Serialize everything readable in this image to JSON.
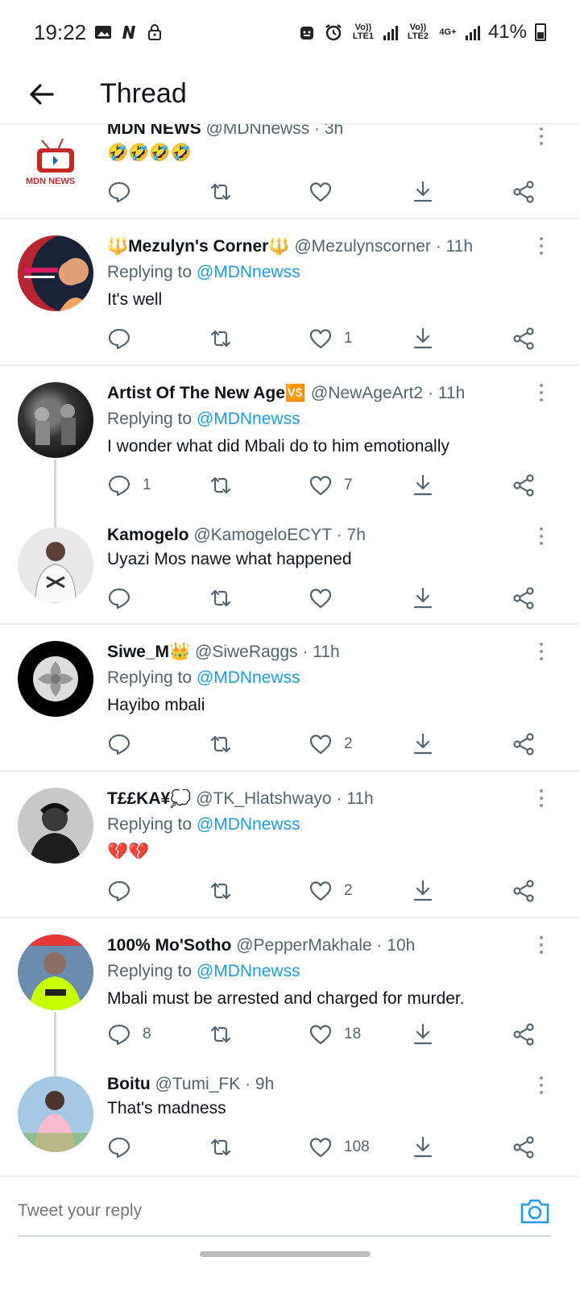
{
  "status_bar": {
    "time": "19:22",
    "net1": "Vo)) LTE1",
    "net2": "Vo)) LTE2",
    "net3": "4G+",
    "battery": "41%"
  },
  "header": {
    "back_icon": "arrow-left-icon",
    "title": "Thread"
  },
  "tweets": [
    {
      "name": "MDN NEWS",
      "handle": "@MDNnewss",
      "time": "· 3h",
      "replying_prefix": "",
      "replying_to": "",
      "text": "🤣🤣🤣🤣",
      "replies": "",
      "likes": ""
    },
    {
      "name": "🔱Mezulyn's Corner🔱",
      "handle": "@Mezulynscorner",
      "time": "· 11h",
      "replying_prefix": "Replying to",
      "replying_to": "@MDNnewss",
      "text": "It's well",
      "replies": "",
      "likes": "1"
    },
    {
      "name": "Artist Of The New Age🆚",
      "handle": "@NewAgeArt2",
      "time": "· 11h",
      "replying_prefix": "Replying to",
      "replying_to": "@MDNnewss",
      "text": "I wonder what did Mbali do to him emotionally",
      "replies": "1",
      "likes": "7"
    },
    {
      "name": "Kamogelo",
      "handle": "@KamogeloECYT",
      "time": "· 7h",
      "replying_prefix": "",
      "replying_to": "",
      "text": "Uyazi Mos nawe what happened",
      "replies": "",
      "likes": ""
    },
    {
      "name": "Siwe_M👑",
      "handle": "@SiweRaggs",
      "time": "· 11h",
      "replying_prefix": "Replying to",
      "replying_to": "@MDNnewss",
      "text": "Hayibo mbali",
      "replies": "",
      "likes": "2"
    },
    {
      "name": "T££KA¥💭",
      "handle": "@TK_Hlatshwayo",
      "time": "· 11h",
      "replying_prefix": "Replying to",
      "replying_to": "@MDNnewss",
      "text": "💔💔",
      "replies": "",
      "likes": "2"
    },
    {
      "name": "100% Mo'Sotho",
      "handle": "@PepperMakhale",
      "time": "· 10h",
      "replying_prefix": "Replying to",
      "replying_to": "@MDNnewss",
      "text": "Mbali must be arrested and charged for murder.",
      "replies": "8",
      "likes": "18"
    },
    {
      "name": "Boitu",
      "handle": "@Tumi_FK",
      "time": "· 9h",
      "replying_prefix": "",
      "replying_to": "",
      "text": "That's madness",
      "replies": "",
      "likes": "108"
    }
  ],
  "avatar_labels": {
    "mdn_logo": "MDN NEWS"
  },
  "reply_bar": {
    "placeholder": "Tweet your reply",
    "camera_icon": "camera-icon"
  },
  "colors": {
    "accent": "#1d9bf0",
    "secondary_text": "#536471",
    "primary_text": "#0f1419"
  }
}
